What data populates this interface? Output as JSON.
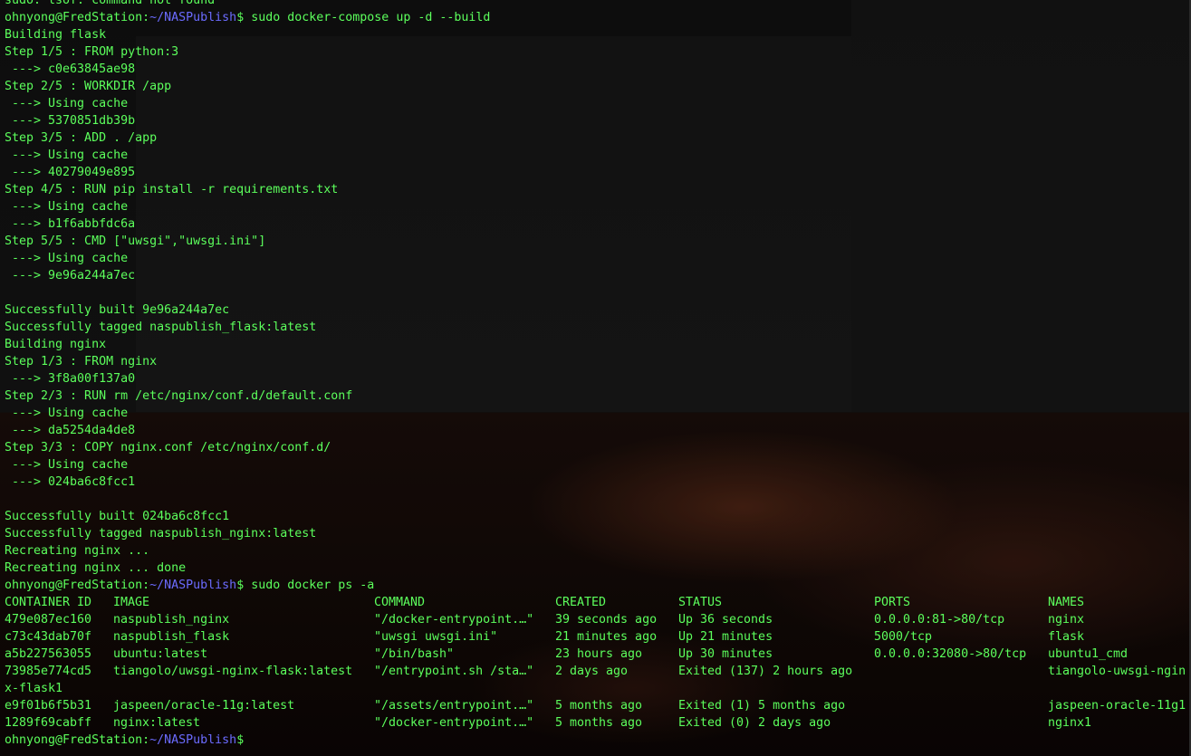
{
  "terminal": {
    "top_partial": "sudo: lsof: command not found",
    "prompt": {
      "user_host": "ohnyong@FredStation:",
      "path": "~/NASPublish",
      "symbol": "$"
    },
    "command1": " sudo docker-compose up -d --build",
    "build_output": [
      "Building flask",
      "Step 1/5 : FROM python:3",
      " ---> c0e63845ae98",
      "Step 2/5 : WORKDIR /app",
      " ---> Using cache",
      " ---> 5370851db39b",
      "Step 3/5 : ADD . /app",
      " ---> Using cache",
      " ---> 40279049e895",
      "Step 4/5 : RUN pip install -r requirements.txt",
      " ---> Using cache",
      " ---> b1f6abbfdc6a",
      "Step 5/5 : CMD [\"uwsgi\",\"uwsgi.ini\"]",
      " ---> Using cache",
      " ---> 9e96a244a7ec",
      "",
      "Successfully built 9e96a244a7ec",
      "Successfully tagged naspublish_flask:latest",
      "Building nginx",
      "Step 1/3 : FROM nginx",
      " ---> 3f8a00f137a0",
      "Step 2/3 : RUN rm /etc/nginx/conf.d/default.conf",
      " ---> Using cache",
      " ---> da5254da4de8",
      "Step 3/3 : COPY nginx.conf /etc/nginx/conf.d/",
      " ---> Using cache",
      " ---> 024ba6c8fcc1",
      "",
      "Successfully built 024ba6c8fcc1",
      "Successfully tagged naspublish_nginx:latest",
      "Recreating nginx ...",
      "Recreating nginx ... done"
    ],
    "command2": " sudo docker ps -a",
    "ps_table": {
      "headers": [
        "CONTAINER ID",
        "IMAGE",
        "COMMAND",
        "CREATED",
        "STATUS",
        "PORTS",
        "NAMES"
      ],
      "rows": [
        [
          "479e087ec160",
          "naspublish_nginx",
          "\"/docker-entrypoint.…\"",
          "39 seconds ago",
          "Up 36 seconds",
          "0.0.0.0:81->80/tcp",
          "nginx"
        ],
        [
          "c73c43dab70f",
          "naspublish_flask",
          "\"uwsgi uwsgi.ini\"",
          "21 minutes ago",
          "Up 21 minutes",
          "5000/tcp",
          "flask"
        ],
        [
          "a5b227563055",
          "ubuntu:latest",
          "\"/bin/bash\"",
          "23 hours ago",
          "Up 30 minutes",
          "0.0.0.0:32080->80/tcp",
          "ubuntu1_cmd"
        ],
        [
          "73985e774cd5",
          "tiangolo/uwsgi-nginx-flask:latest",
          "\"/entrypoint.sh /sta…\"",
          "2 days ago",
          "Exited (137) 2 hours ago",
          "",
          "tiangolo-uwsgi-ngin"
        ],
        [
          "e9f01b6f5b31",
          "jaspeen/oracle-11g:latest",
          "\"/assets/entrypoint.…\"",
          "5 months ago",
          "Exited (1) 5 months ago",
          "",
          "jaspeen-oracle-11g1"
        ],
        [
          "1289f69cabff",
          "nginx:latest",
          "\"/docker-entrypoint.…\"",
          "5 months ago",
          "Exited (0) 2 days ago",
          "",
          "nginx1"
        ]
      ],
      "wrap_after_row_3": "x-flask1"
    },
    "colors": {
      "text_green": "#5cff5c",
      "path_blue": "#6b6bff",
      "background": "#000000"
    }
  }
}
